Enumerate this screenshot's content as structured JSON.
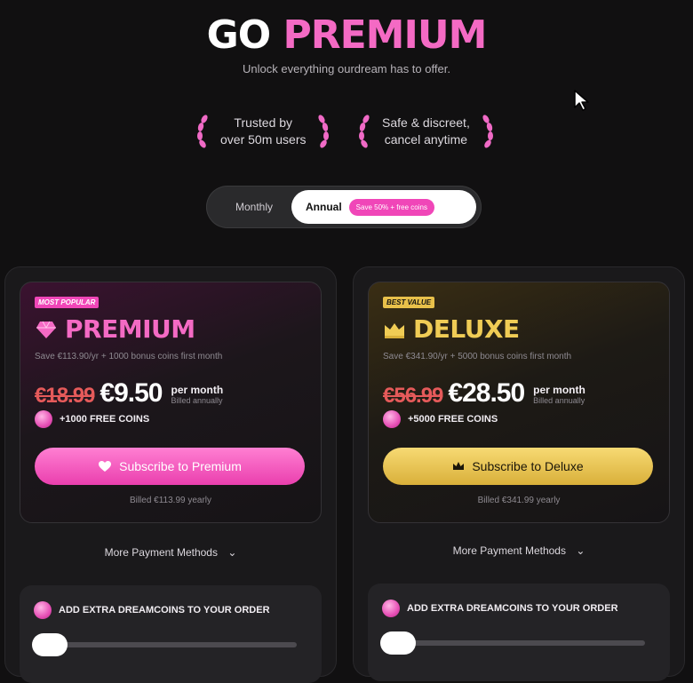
{
  "header": {
    "title_part1": "GO",
    "title_part2": "PREMIUM",
    "subtitle": "Unlock everything ourdream has to offer."
  },
  "trust_badges": [
    {
      "line1": "Trusted by",
      "line2": "over 50m users"
    },
    {
      "line1": "Safe & discreet,",
      "line2": "cancel anytime"
    }
  ],
  "billing_toggle": {
    "monthly_label": "Monthly",
    "annual_label": "Annual",
    "annual_badge": "Save 50% + free coins",
    "selected": "Annual"
  },
  "plans": [
    {
      "tag": "MOST POPULAR",
      "name": "PREMIUM",
      "icon": "heart-gem-icon",
      "save_line": "Save €113.90/yr + 1000 bonus coins first month",
      "old_price": "€18.99",
      "new_price": "€9.50",
      "per": "per month",
      "billed_note": "Billed annually",
      "coins": "+1000 FREE COINS",
      "cta": "Subscribe to Premium",
      "billed_yearly": "Billed €113.99 yearly",
      "more_methods": "More Payment Methods",
      "extra_title": "ADD EXTRA DREAMCOINS TO YOUR ORDER",
      "accent": "#f46ac4"
    },
    {
      "tag": "BEST VALUE",
      "name": "DELUXE",
      "icon": "crown-icon",
      "save_line": "Save €341.90/yr + 5000 bonus coins first month",
      "old_price": "€56.99",
      "new_price": "€28.50",
      "per": "per month",
      "billed_note": "Billed annually",
      "coins": "+5000 FREE COINS",
      "cta": "Subscribe to Deluxe",
      "billed_yearly": "Billed €341.99 yearly",
      "more_methods": "More Payment Methods",
      "extra_title": "ADD EXTRA DREAMCOINS TO YOUR ORDER",
      "accent": "#f0cc55"
    }
  ]
}
